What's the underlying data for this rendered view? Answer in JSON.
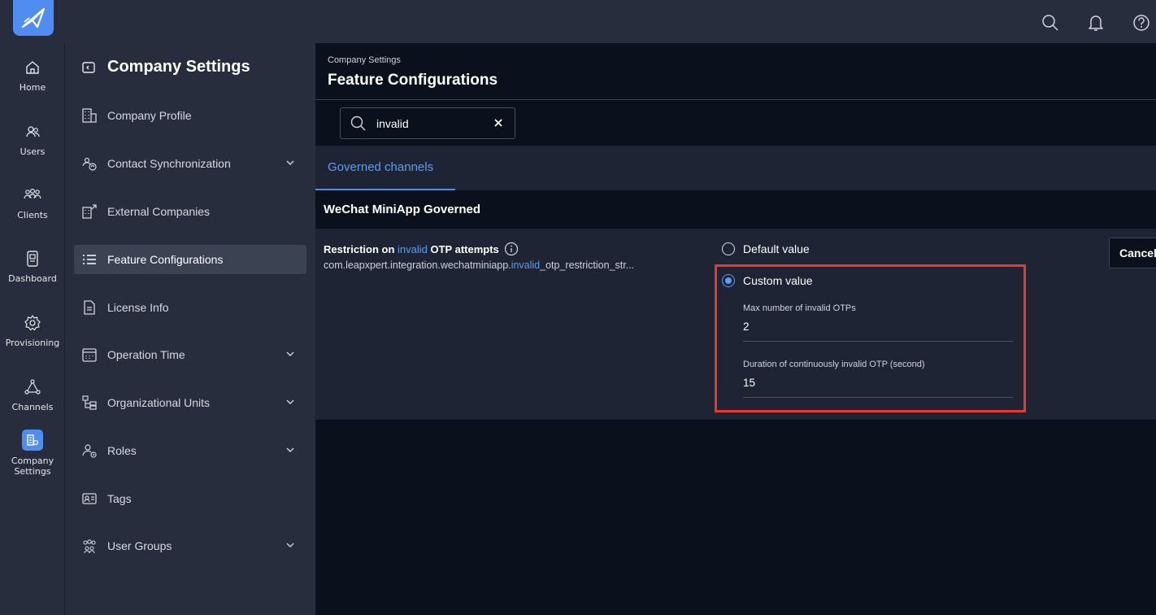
{
  "colors": {
    "accent": "#4f8ef0",
    "highlight_box": "#e53b2e",
    "link": "#5b9cf5"
  },
  "topbar": {
    "logo_icon": "paper-plane-logo",
    "icons": [
      "search-icon",
      "bell-icon",
      "help-icon"
    ]
  },
  "rail": {
    "items": [
      {
        "label": "Home",
        "icon": "home-icon"
      },
      {
        "label": "Users",
        "icon": "users-icon"
      },
      {
        "label": "Clients",
        "icon": "clients-icon"
      },
      {
        "label": "Dashboard",
        "icon": "dashboard-icon"
      },
      {
        "label": "Provisioning",
        "icon": "gear-icon"
      },
      {
        "label": "Channels",
        "icon": "channels-icon"
      },
      {
        "label": "Company Settings",
        "icon": "company-settings-icon",
        "active": true
      }
    ]
  },
  "sidebar": {
    "title": "Company Settings",
    "items": [
      {
        "label": "Company Profile",
        "icon": "building-icon",
        "expandable": false
      },
      {
        "label": "Contact Synchronization",
        "icon": "contact-sync-icon",
        "expandable": true
      },
      {
        "label": "External Companies",
        "icon": "external-companies-icon",
        "expandable": false
      },
      {
        "label": "Feature Configurations",
        "icon": "list-icon",
        "expandable": false,
        "active": true
      },
      {
        "label": "License Info",
        "icon": "document-icon",
        "expandable": false
      },
      {
        "label": "Operation Time",
        "icon": "calendar-icon",
        "expandable": true
      },
      {
        "label": "Organizational Units",
        "icon": "org-units-icon",
        "expandable": true
      },
      {
        "label": "Roles",
        "icon": "roles-icon",
        "expandable": true
      },
      {
        "label": "Tags",
        "icon": "tag-icon",
        "expandable": false
      },
      {
        "label": "User Groups",
        "icon": "user-groups-icon",
        "expandable": true
      }
    ]
  },
  "main": {
    "breadcrumb": "Company Settings",
    "title": "Feature Configurations",
    "search": {
      "value": "invalid",
      "placeholder": ""
    },
    "tabs": [
      {
        "label": "Governed channels",
        "active": true
      }
    ],
    "group": "WeChat MiniApp Governed",
    "config": {
      "name_prefix": "Restriction on ",
      "name_match": "invalid",
      "name_suffix": " OTP attempts",
      "key_prefix": "com.leapxpert.integration.wechatminiapp.",
      "key_match": "invalid",
      "key_suffix": "_otp_restriction_str...",
      "options": {
        "default": "Default value",
        "custom": "Custom value"
      },
      "selected": "custom",
      "fields": [
        {
          "label": "Max number of invalid OTPs",
          "value": "2"
        },
        {
          "label": "Duration of continuously invalid OTP (second)",
          "value": "15"
        }
      ],
      "cancel_label": "Cancel"
    }
  }
}
